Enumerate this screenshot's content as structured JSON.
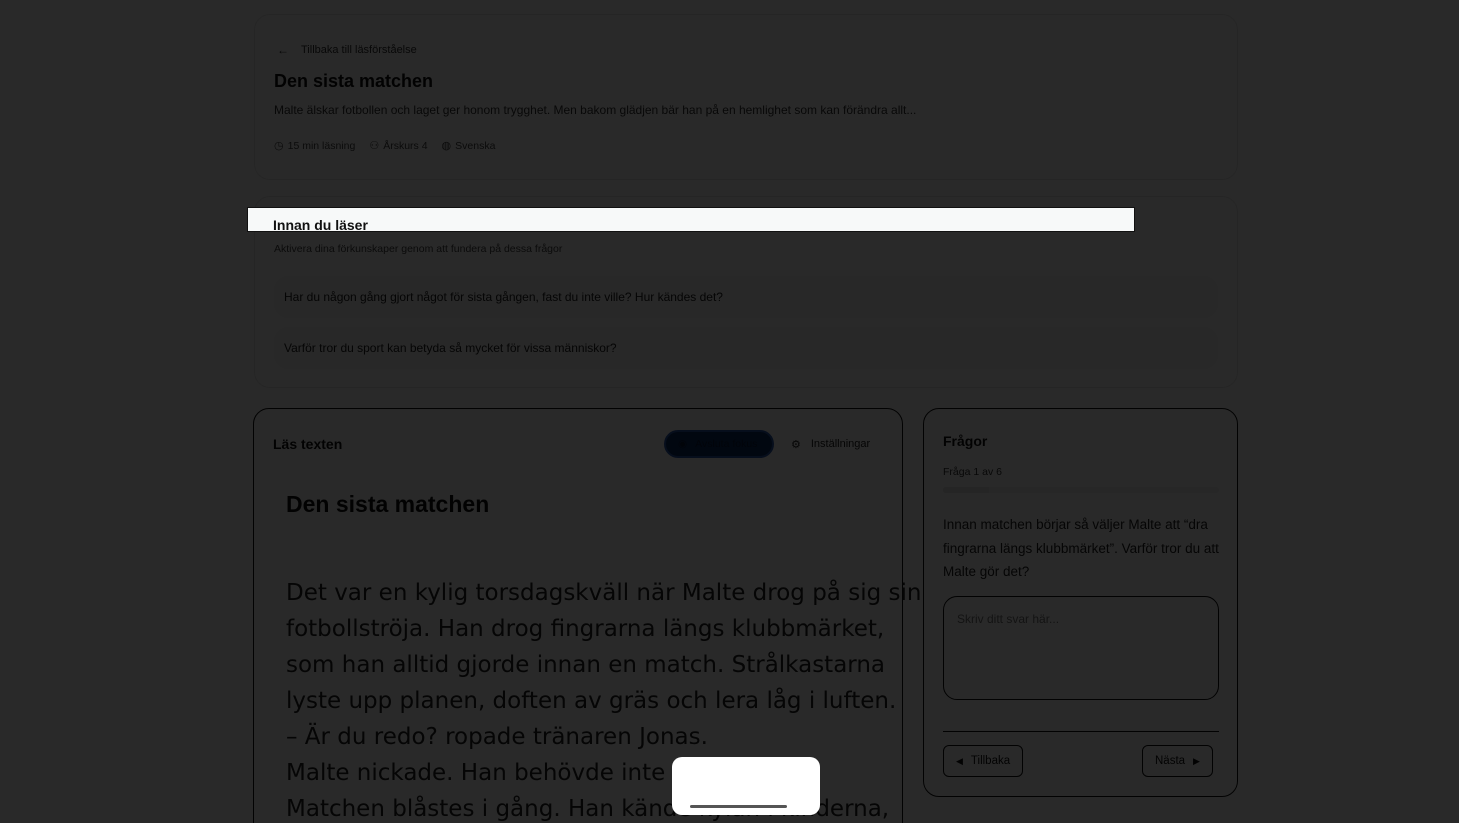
{
  "header": {
    "back_label": "Tillbaka till läsförståelse",
    "title": "Den sista matchen",
    "description": "Malte älskar fotbollen och laget ger honom trygghet. Men bakom glädjen bär han på en hemlighet som kan förändra allt...",
    "meta": {
      "duration": "15 min läsning",
      "grade": "Årskurs 4",
      "language": "Svenska"
    }
  },
  "pre_reading": {
    "title": "Innan du läser",
    "subtitle": "Aktivera dina förkunskaper genom att fundera på dessa frågor",
    "questions": [
      "Har du någon gång gjort något för sista gången, fast du inte ville? Hur kändes det?",
      "Varför tror du sport kan betyda så mycket för vissa människor?"
    ]
  },
  "reader": {
    "heading": "Läs texten",
    "focus_button": "Avsluta fokus",
    "settings_button": "Inställningar",
    "text_title": "Den sista matchen",
    "lines": [
      "Det var en kylig torsdagskväll när Malte drog på sig sin",
      "fotbollströja. Han drog fingrarna längs klubbmärket,",
      "som han alltid gjorde innan en match. Strålkastarna",
      "lyste upp planen, doften av gräs och lera låg i luften.",
      "– Är du redo? ropade tränaren Jonas.",
      "Malte nickade. Han behövde inte säga",
      "Matchen blåstes i gång. Han kände kylan i kinderna,"
    ]
  },
  "questions_panel": {
    "title": "Frågor",
    "counter": "Fråga 1 av 6",
    "progress": 0.1667,
    "question": "Innan matchen börjar så väljer Malte att “dra fingrarna längs klubbmärket”. Varför tror du att Malte gör det?",
    "answer_placeholder": "Skriv ditt svar här...",
    "prev_label": "Tillbaka",
    "next_label": "Nästa"
  }
}
